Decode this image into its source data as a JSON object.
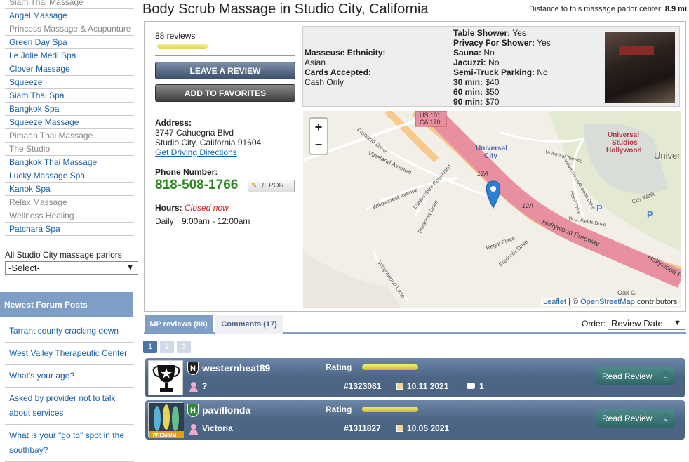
{
  "sidebar": {
    "parlors": [
      {
        "label": "Siam Thai Massage",
        "gray": true
      },
      {
        "label": "Angel Massage",
        "gray": false
      },
      {
        "label": "Princess Massage & Acupunture",
        "gray": true
      },
      {
        "label": "Green Day Spa",
        "gray": false
      },
      {
        "label": "Le Jolie Medi Spa",
        "gray": false
      },
      {
        "label": "Clover Massage",
        "gray": false
      },
      {
        "label": "Squeeze",
        "gray": false
      },
      {
        "label": "Siam Thai Spa",
        "gray": false
      },
      {
        "label": "Bangkok Spa",
        "gray": false
      },
      {
        "label": "Squeeze Massage",
        "gray": false
      },
      {
        "label": "Pimaan Thai Massage",
        "gray": true
      },
      {
        "label": "The Studio",
        "gray": true
      },
      {
        "label": "Bangkok Thai Massage",
        "gray": false
      },
      {
        "label": "Lucky Massage Spa",
        "gray": false
      },
      {
        "label": "Kanok Spa",
        "gray": false
      },
      {
        "label": "Relax Massage",
        "gray": true
      },
      {
        "label": "Wellness Healing",
        "gray": true
      },
      {
        "label": "Patchara Spa",
        "gray": false
      }
    ],
    "all_parlors_label": "All Studio City massage parlors",
    "select_value": "-Select-",
    "forum_header": "Newest Forum Posts",
    "forum_posts": [
      "Tarrant county cracking down",
      "West Valley Therapeutic Center",
      "What's your age?",
      "Asked by provider not to talk about services",
      "What is your \"go to\" spot in the southbay?"
    ]
  },
  "header": {
    "title": "Body Scrub Massage in Studio City, California",
    "distance_label": "Distance to this massage parlor center:",
    "distance_value": "8.9 mi"
  },
  "summary": {
    "reviews_count": "88 reviews",
    "leave_review": "LEAVE A REVIEW",
    "add_favorites": "ADD TO FAVORITES"
  },
  "details": {
    "ethnicity_label": "Masseuse Ethnicity:",
    "ethnicity_value": "Asian",
    "cards_label": "Cards Accepted:",
    "cards_value": "Cash Only",
    "table_shower_label": "Table Shower:",
    "table_shower_value": "Yes",
    "privacy_label": "Privacy For Shower:",
    "privacy_value": "Yes",
    "sauna_label": "Sauna:",
    "sauna_value": "No",
    "jacuzzi_label": "Jacuzzi:",
    "jacuzzi_value": "No",
    "truck_label": "Semi-Truck Parking:",
    "truck_value": "No",
    "p30_label": "30 min:",
    "p30_value": "$40",
    "p60_label": "60 min:",
    "p60_value": "$50",
    "p90_label": "90 min:",
    "p90_value": "$70"
  },
  "contact": {
    "address_label": "Address:",
    "address_line1": "3747 Cahuegna Blvd",
    "address_line2": "Studio City, California 91604",
    "driving_link": "Get Driving Directions",
    "phone_label": "Phone Number:",
    "phone": "818-508-1766",
    "report": "REPORT",
    "hours_label": "Hours:",
    "hours_status": "Closed now",
    "daily_label": "Daily",
    "daily_time": "9:00am - 12:00am"
  },
  "map": {
    "zoom_in": "+",
    "zoom_out": "−",
    "labels": {
      "us101": "US 101",
      "ca170": "CA 170",
      "universal_city": "Universal",
      "universal_city2": "City",
      "studios1": "Universal",
      "studios2": "Studios",
      "studios3": "Hollywood",
      "univer": "Univer",
      "fruitland": "Fruitland Drive",
      "vineland": "Vineland Avenue",
      "lankershim": "Lankershim Boulevard",
      "willowcrest": "Willowcrest Avenue",
      "fredonia": "Fredonia Drive",
      "fredonia2": "Fredonia Drive",
      "regal": "Regal Place",
      "wrightwood": "Wrightwood Lane",
      "hollywood_fwy": "Hollywood Freeway",
      "hollywood_fwy2": "Hollywood Fre",
      "universal_hollywood_dr": "Universal Hollywood Drive",
      "hotel_dr": "Hotel Drive",
      "wc_fields": "W.C. Fields Drive",
      "universal_terrace": "Universal Terrace",
      "city_walk": "City Walk",
      "oak": "Oak G",
      "exit12a": "12A",
      "exit12a_2": "12A",
      "p": "P"
    },
    "attrib_leaflet": "Leaflet",
    "attrib_sep": " | © ",
    "attrib_osm": "OpenStreetMap",
    "attrib_tail": " contributors"
  },
  "tabs": {
    "active": "MP reviews (88)",
    "inactive": "Comments (17)",
    "order_label": "Order:",
    "order_value": "Review Date"
  },
  "pages": [
    "1",
    "2",
    "3"
  ],
  "reviews": [
    {
      "name": "westernheat89",
      "badge": "N",
      "rating_label": "Rating",
      "location": "?",
      "id": "#1323081",
      "date": "10.11 2021",
      "comments": "1",
      "read": "Read Review"
    },
    {
      "name": "pavillonda",
      "badge": "H",
      "rating_label": "Rating",
      "location": "Victoria",
      "id": "#1311827",
      "date": "10.05 2021",
      "comments": "",
      "read": "Read Review",
      "premium": "PREMIUM"
    }
  ]
}
